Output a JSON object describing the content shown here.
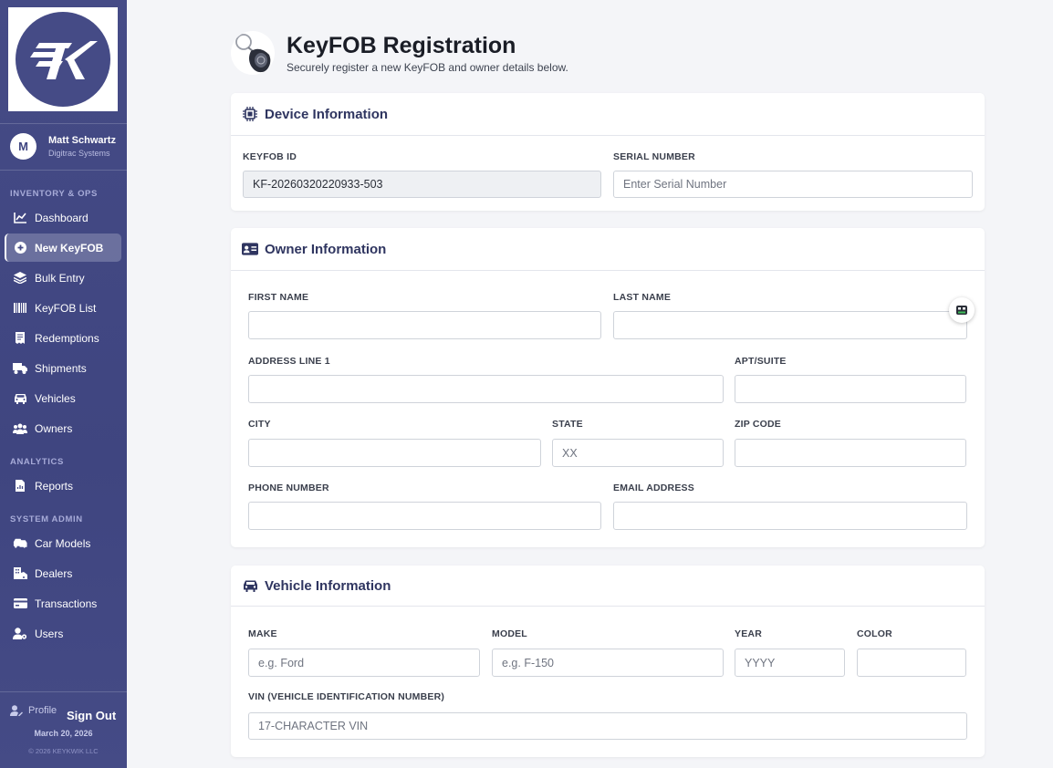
{
  "sidebar": {
    "user": {
      "initial": "M",
      "name": "Matt Schwartz",
      "org": "Digitrac Systems"
    },
    "sections": {
      "inventory": "INVENTORY & OPS",
      "analytics": "ANALYTICS",
      "admin": "SYSTEM ADMIN"
    },
    "items": {
      "dashboard": "Dashboard",
      "new_keyfob": "New KeyFOB",
      "bulk_entry": "Bulk Entry",
      "keyfob_list": "KeyFOB List",
      "redemptions": "Redemptions",
      "shipments": "Shipments",
      "vehicles": "Vehicles",
      "owners": "Owners",
      "reports": "Reports",
      "car_models": "Car Models",
      "dealers": "Dealers",
      "transactions": "Transactions",
      "users": "Users"
    },
    "active_item": "New KeyFOB",
    "footer": {
      "profile": "Profile",
      "sign_out": "Sign Out",
      "date": "March 20, 2026",
      "copyright": "© 2026 KEYKWIK LLC"
    }
  },
  "header": {
    "title": "KeyFOB Registration",
    "subtitle": "Securely register a new KeyFOB and owner details below."
  },
  "device": {
    "title": "Device Information",
    "keyfob_id_label": "KEYFOB ID",
    "keyfob_id_value": "KF-20260320220933-503",
    "serial_label": "SERIAL NUMBER",
    "serial_placeholder": "Enter Serial Number"
  },
  "owner": {
    "title": "Owner Information",
    "first_name_label": "FIRST NAME",
    "last_name_label": "LAST NAME",
    "address_label": "ADDRESS LINE 1",
    "apt_label": "APT/SUITE",
    "city_label": "CITY",
    "state_label": "STATE",
    "state_placeholder": "XX",
    "zip_label": "ZIP CODE",
    "phone_label": "PHONE NUMBER",
    "email_label": "EMAIL ADDRESS"
  },
  "vehicle": {
    "title": "Vehicle Information",
    "make_label": "MAKE",
    "make_placeholder": "e.g. Ford",
    "model_label": "MODEL",
    "model_placeholder": "e.g. F-150",
    "year_label": "YEAR",
    "year_placeholder": "YYYY",
    "color_label": "COLOR",
    "vin_label": "VIN (VEHICLE IDENTIFICATION NUMBER)",
    "vin_placeholder": "17-CHARACTER VIN"
  },
  "colors": {
    "sidebar": "#454b86",
    "accent": "#2f3560",
    "page_bg": "#f4f5f8"
  }
}
